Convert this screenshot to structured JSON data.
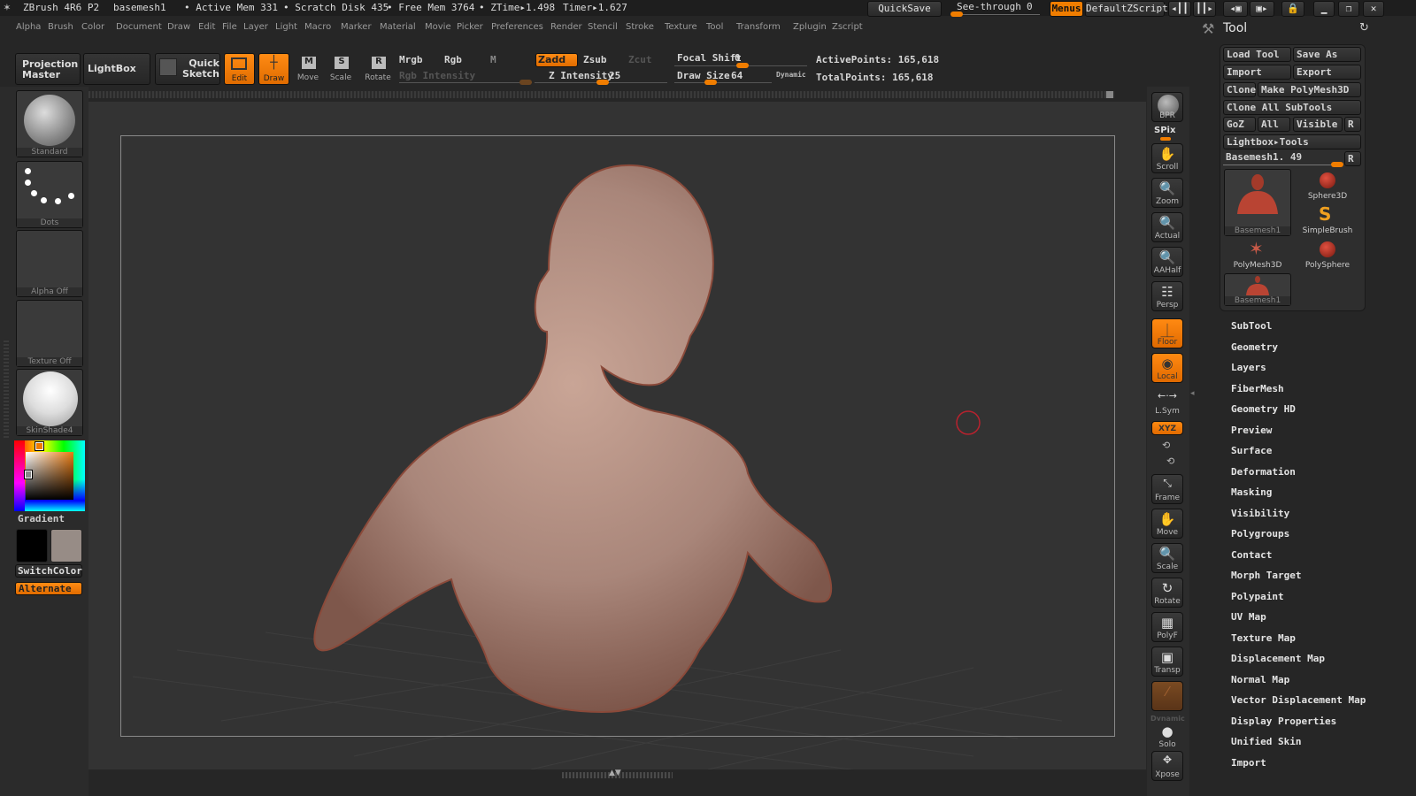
{
  "titlebar": {
    "app": "ZBrush 4R6 P2",
    "document": "basemesh1",
    "active_mem": "• Active Mem 331",
    "scratch_disk": "• Scratch Disk 435",
    "free_mem": "• Free Mem 3764",
    "ztime": "• ZTime▸1.498",
    "timer": "Timer▸1.627",
    "quicksave": "QuickSave",
    "see_through_label": "See-through",
    "see_through_value": "0",
    "see_through_fraction": 0,
    "menus": "Menus",
    "default_zscript": "DefaultZScript"
  },
  "menubar": [
    "Alpha",
    "Brush",
    "Color",
    "Document",
    "Draw",
    "Edit",
    "File",
    "Layer",
    "Light",
    "Macro",
    "Marker",
    "Material",
    "Movie",
    "Picker",
    "Preferences",
    "Render",
    "Stencil",
    "Stroke",
    "Texture",
    "Tool",
    "Transform",
    "Zplugin",
    "Zscript"
  ],
  "toolbar": {
    "projection_master": "Projection Master",
    "lightbox": "LightBox",
    "quick_sketch": "Quick Sketch",
    "edit": "Edit",
    "draw": "Draw",
    "move": "Move",
    "scale": "Scale",
    "rotate": "Rotate",
    "mrgb": "Mrgb",
    "rgb": "Rgb",
    "m": "M",
    "rgb_intensity": "Rgb Intensity",
    "zadd": "Zadd",
    "zsub": "Zsub",
    "zcut": "Zcut",
    "z_intensity_label": "Z Intensity",
    "z_intensity_value": "25",
    "focal_shift_label": "Focal Shift",
    "focal_shift_value": "0",
    "draw_size_label": "Draw Size",
    "draw_size_value": "64",
    "dynamic": "Dynamic",
    "active_points": "ActivePoints: 165,618",
    "total_points": "TotalPoints: 165,618"
  },
  "leftpanel": {
    "brush": "Standard",
    "stroke": "Dots",
    "alpha": "Alpha Off",
    "texture": "Texture Off",
    "material": "SkinShade4",
    "gradient": "Gradient",
    "switch_color": "SwitchColor",
    "alternate": "Alternate",
    "main_color": "#000000",
    "secondary_color": "#978c86"
  },
  "shelf": {
    "bpr": "BPR",
    "spix": "SPix",
    "scroll": "Scroll",
    "zoom": "Zoom",
    "actual": "Actual",
    "aahalf": "AAHalf",
    "persp": "Persp",
    "floor": "Floor",
    "local": "Local",
    "lsym": "L.Sym",
    "xyz": "XYZ",
    "frame": "Frame",
    "move": "Move",
    "scale": "Scale",
    "rotate": "Rotate",
    "polyf": "PolyF",
    "transp": "Transp",
    "dynamic": "Dynamic",
    "solo": "Solo",
    "xpose": "Xpose"
  },
  "tool": {
    "title": "Tool",
    "load_tool": "Load Tool",
    "save_as": "Save As",
    "import": "Import",
    "export": "Export",
    "clone": "Clone",
    "make_polymesh": "Make PolyMesh3D",
    "clone_all": "Clone All SubTools",
    "goz": "GoZ",
    "all": "All",
    "visible": "Visible",
    "r": "R",
    "lightbox_tools": "Lightbox▸Tools",
    "current_tool": "Basemesh1. 49",
    "tiles": [
      "Basemesh1",
      "Sphere3D",
      "SimpleBrush",
      "PolyMesh3D",
      "PolySphere",
      "Basemesh1"
    ],
    "sections": [
      "SubTool",
      "Geometry",
      "Layers",
      "FiberMesh",
      "Geometry HD",
      "Preview",
      "Surface",
      "Deformation",
      "Masking",
      "Visibility",
      "Polygroups",
      "Contact",
      "Morph Target",
      "Polypaint",
      "UV Map",
      "Texture Map",
      "Displacement Map",
      "Normal Map",
      "Vector Displacement Map",
      "Display Properties",
      "Unified Skin",
      "Import"
    ]
  }
}
